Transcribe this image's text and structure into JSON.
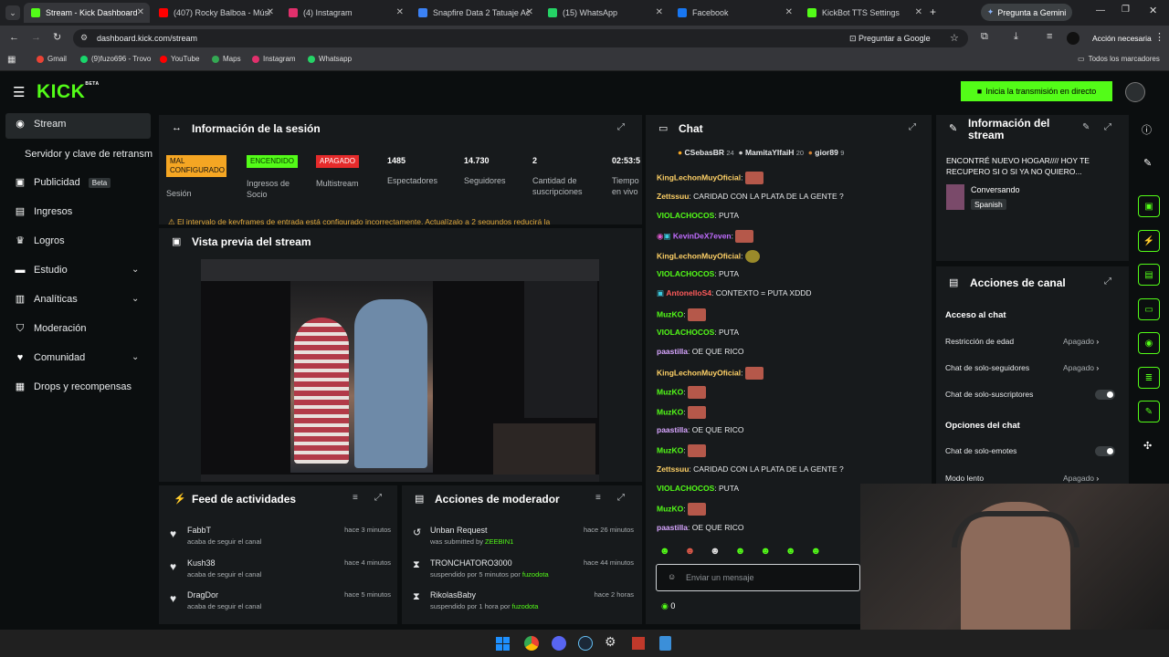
{
  "browser": {
    "tabs": [
      {
        "label": "Stream - Kick Dashboard",
        "color": "#53fc18"
      },
      {
        "label": "(407) Rocky Balboa - Músi",
        "color": "#ff0000"
      },
      {
        "label": "(4) Instagram",
        "color": "#e1306c"
      },
      {
        "label": "Snapfire Data 2 Tatuaje Ac",
        "color": "#3b82f6"
      },
      {
        "label": "(15) WhatsApp",
        "color": "#25d366"
      },
      {
        "label": "Facebook",
        "color": "#1877f2"
      },
      {
        "label": "KickBot TTS Settings",
        "color": "#53fc18"
      }
    ],
    "gemini_button": "Pregunta a Gemini",
    "url": "dashboard.kick.com/stream",
    "ask_google": "Preguntar a Google",
    "action_required": "Acción necesaria",
    "bookmarks": [
      {
        "label": "Gmail",
        "color": "#ea4335"
      },
      {
        "label": "(9)fuzo696 - Trovo",
        "color": "#19d66b"
      },
      {
        "label": "YouTube",
        "color": "#ff0000"
      },
      {
        "label": "Maps",
        "color": "#34a853"
      },
      {
        "label": "Instagram",
        "color": "#e1306c"
      },
      {
        "label": "Whatsapp",
        "color": "#25d366"
      }
    ],
    "all_bookmarks": "Todos los marcadores"
  },
  "kick": {
    "logo": "KICK",
    "logo_sup": "BETA",
    "go_live": "Inicia la transmisión en directo",
    "accent": "#53fc18"
  },
  "sidebar": {
    "items": [
      {
        "label": "Stream",
        "icon": "broadcast-icon"
      },
      {
        "label": "Servidor y clave de retransm"
      },
      {
        "label": "Publicidad",
        "badge": "Beta",
        "icon": "megaphone-icon"
      },
      {
        "label": "Ingresos",
        "icon": "ledger-icon"
      },
      {
        "label": "Logros",
        "icon": "trophy-icon"
      },
      {
        "label": "Estudio",
        "icon": "studio-icon"
      },
      {
        "label": "Analíticas",
        "icon": "chart-icon"
      },
      {
        "label": "Moderación",
        "icon": "shield-icon"
      },
      {
        "label": "Comunidad",
        "icon": "heart-icon"
      },
      {
        "label": "Drops y recompensas",
        "icon": "gift-icon"
      }
    ]
  },
  "session": {
    "title": "Información de la sesión",
    "stats": [
      {
        "value": "MAL CONFIGURADO",
        "label": "Sesión"
      },
      {
        "value": "ENCENDIDO",
        "label": "Ingresos de Socio"
      },
      {
        "value": "APAGADO",
        "label": "Multistream"
      },
      {
        "value": "1485",
        "label": "Espectadores"
      },
      {
        "value": "14.730",
        "label": "Seguidores"
      },
      {
        "value": "2",
        "label": "Cantidad de suscripciones"
      },
      {
        "value": "02:53:5",
        "label": "Tiempo en vivo"
      }
    ],
    "warning": "El intervalo de keyframes de entrada está configurado incorrectamente. Actualízalo a 2 segundos reducirá la"
  },
  "preview": {
    "title": "Vista previa del stream"
  },
  "activity": {
    "title": "Feed de actividades",
    "items": [
      {
        "user": "FabbT",
        "desc": "acaba de seguir el canal",
        "time": "hace 3 minutos"
      },
      {
        "user": "Kush38",
        "desc": "acaba de seguir el canal",
        "time": "hace 4 minutos"
      },
      {
        "user": "DragDor",
        "desc": "acaba de seguir el canal",
        "time": "hace 5 minutos"
      }
    ]
  },
  "modactions": {
    "title": "Acciones de moderador",
    "items": [
      {
        "title": "Unban Request",
        "desc": "was submitted by",
        "who": "ZEEBIN1",
        "time": "hace 26 minutos"
      },
      {
        "title": "TRONCHATORO3000",
        "desc": "suspendido por 5 minutos por",
        "who": "fuzodota",
        "time": "hace 44 minutos"
      },
      {
        "title": "RikolasBaby",
        "desc": "suspendido por 1 hora por",
        "who": "fuzodota",
        "time": "hace 2 horas"
      }
    ]
  },
  "chat": {
    "title": "Chat",
    "top": [
      {
        "user": "CSebasBR",
        "count": "24"
      },
      {
        "user": "MamitaYIfaiH",
        "count": "20"
      },
      {
        "user": "gior89",
        "count": "9"
      }
    ],
    "messages": [
      {
        "user": "KingLechonMuyOficial",
        "text": "",
        "color": "#ffd166",
        "emote": true
      },
      {
        "user": "Zettssuu",
        "text": "CARIDAD CON LA PLATA DE LA GENTE ?",
        "color": "#ffd166"
      },
      {
        "user": "VIOLACHOCOS",
        "text": "PUTA",
        "color": "#53fc18"
      },
      {
        "user": "KevinDeX7even",
        "text": "",
        "color": "#c06cff",
        "emote": true
      },
      {
        "user": "KingLechonMuyOficial",
        "text": "",
        "color": "#ffd166",
        "emote": true
      },
      {
        "user": "VIOLACHOCOS",
        "text": "PUTA",
        "color": "#53fc18"
      },
      {
        "user": "AntonelloS4",
        "text": "CONTEXTO = PUTA XDDD",
        "color": "#ff5b5b"
      },
      {
        "user": "MuzKO",
        "text": "",
        "color": "#53fc18",
        "emote": true
      },
      {
        "user": "VIOLACHOCOS",
        "text": "PUTA",
        "color": "#53fc18"
      },
      {
        "user": "paastilla",
        "text": "OE QUE RICO",
        "color": "#d8a6ff"
      },
      {
        "user": "KingLechonMuyOficial",
        "text": "",
        "color": "#ffd166",
        "emote": true
      },
      {
        "user": "MuzKO",
        "text": "",
        "color": "#53fc18",
        "emote": true
      },
      {
        "user": "MuzKO",
        "text": "",
        "color": "#53fc18",
        "emote": true
      },
      {
        "user": "paastilla",
        "text": "OE QUE RICO",
        "color": "#d8a6ff"
      },
      {
        "user": "MuzKO",
        "text": "",
        "color": "#53fc18",
        "emote": true
      },
      {
        "user": "Zettssuu",
        "text": "CARIDAD CON LA PLATA DE LA GENTE ?",
        "color": "#ffd166"
      },
      {
        "user": "VIOLACHOCOS",
        "text": "PUTA",
        "color": "#53fc18"
      },
      {
        "user": "MuzKO",
        "text": "",
        "color": "#53fc18",
        "emote": true
      },
      {
        "user": "paastilla",
        "text": "OE QUE RICO",
        "color": "#d8a6ff"
      }
    ],
    "input_placeholder": "Enviar un mensaje",
    "points": "0"
  },
  "streaminfo": {
    "title": "Información del stream",
    "stream_title": "ENCONTRÉ NUEVO HOGAR//// HOY TE RECUPERO SI O SI YA NO QUIERO...",
    "category": "Conversando",
    "language": "Spanish"
  },
  "channel": {
    "title": "Acciones de canal",
    "section1": "Acceso al chat",
    "rows1": [
      {
        "label": "Restricción de edad",
        "value": "Apagado"
      },
      {
        "label": "Chat de solo-seguidores",
        "value": "Apagado"
      },
      {
        "label": "Chat de solo-suscriptores",
        "value": ""
      }
    ],
    "section2": "Opciones del chat",
    "rows2": [
      {
        "label": "Chat de solo-emotes",
        "value": ""
      },
      {
        "label": "Modo lento",
        "value": "Apagado"
      }
    ]
  }
}
